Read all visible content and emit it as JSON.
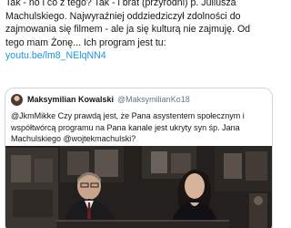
{
  "tweet": {
    "text_lines": [
      "Tak - no i co z tego? Tak - i brat (przyrodni) p. Juliusza",
      "Machulskiego. Najwyraźniej oddziedziczył zdolności do",
      "zajmowania się filmem - ale ja się kulturą nie zajmuję. Od",
      "tego mam Żonę... Ich program jest tu:"
    ],
    "link": "youtu.be/lm8_NElqNN4"
  },
  "quoted_tweet": {
    "author_name": "Maksymilian Kowalski",
    "author_handle": "@MaksymilianKo18",
    "text_lines": [
      "@JkmMikke Czy prawdą jest, że Pana asystentem społecznym i",
      "współtwórcą programu na Pana kanale jest ukryty syn śp. Jana",
      "Machulskiego @wojtekmachulski?"
    ]
  },
  "colors": {
    "link": "#1b95e0",
    "text": "#14171a",
    "muted": "#657786",
    "border": "#ccd6dd"
  },
  "icons": [
    "avatar-image"
  ]
}
